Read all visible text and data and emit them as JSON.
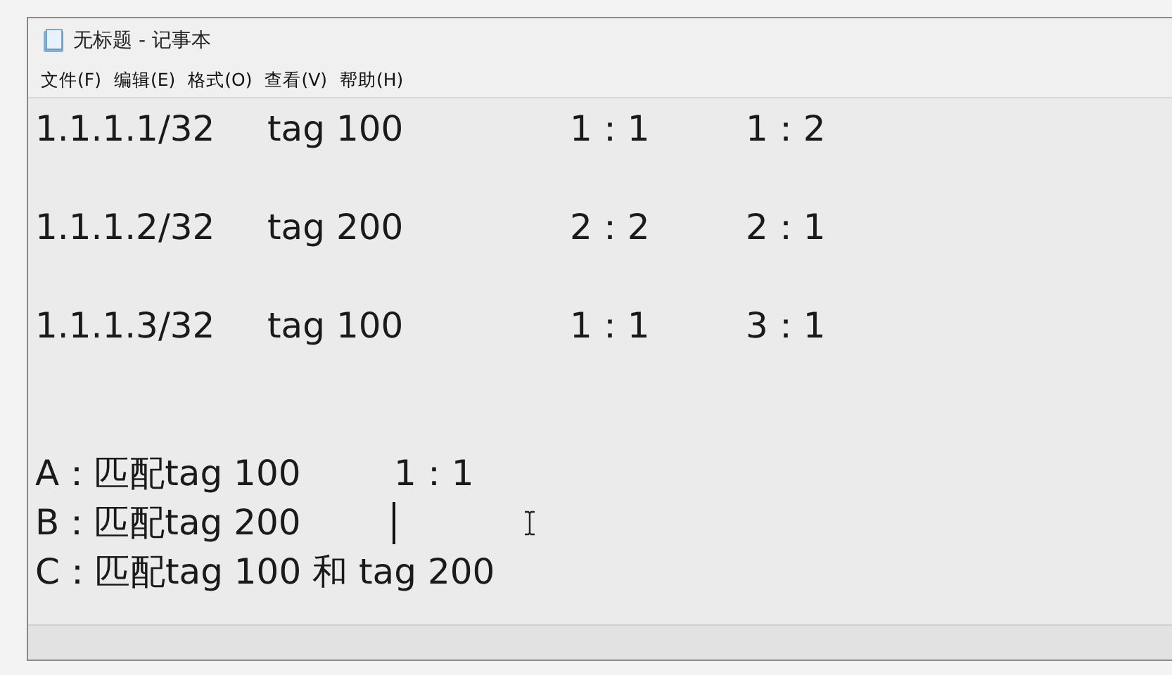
{
  "window": {
    "title": "无标题 - 记事本"
  },
  "menu": [
    "文件(F)",
    "编辑(E)",
    "格式(O)",
    "查看(V)",
    "帮助(H)"
  ],
  "rows": [
    {
      "kind": "entry",
      "cells": [
        "1.1.1.1/32",
        "tag 100",
        "1：1",
        "1：2"
      ]
    },
    {
      "kind": "entry",
      "cells": [
        "1.1.1.2/32",
        "tag 200",
        "2：2",
        "2：1"
      ]
    },
    {
      "kind": "entry",
      "cells": [
        "1.1.1.3/32",
        "tag 100",
        "1：1",
        "3：1"
      ]
    },
    {
      "kind": "option",
      "cells": [
        "A：匹配tag 100",
        "1：1"
      ],
      "caret": false
    },
    {
      "kind": "option",
      "cells": [
        "B：匹配tag 200"
      ],
      "caret": true
    },
    {
      "kind": "option",
      "cells": [
        "C：匹配tag 100 和 tag 200"
      ],
      "caret": false
    }
  ]
}
